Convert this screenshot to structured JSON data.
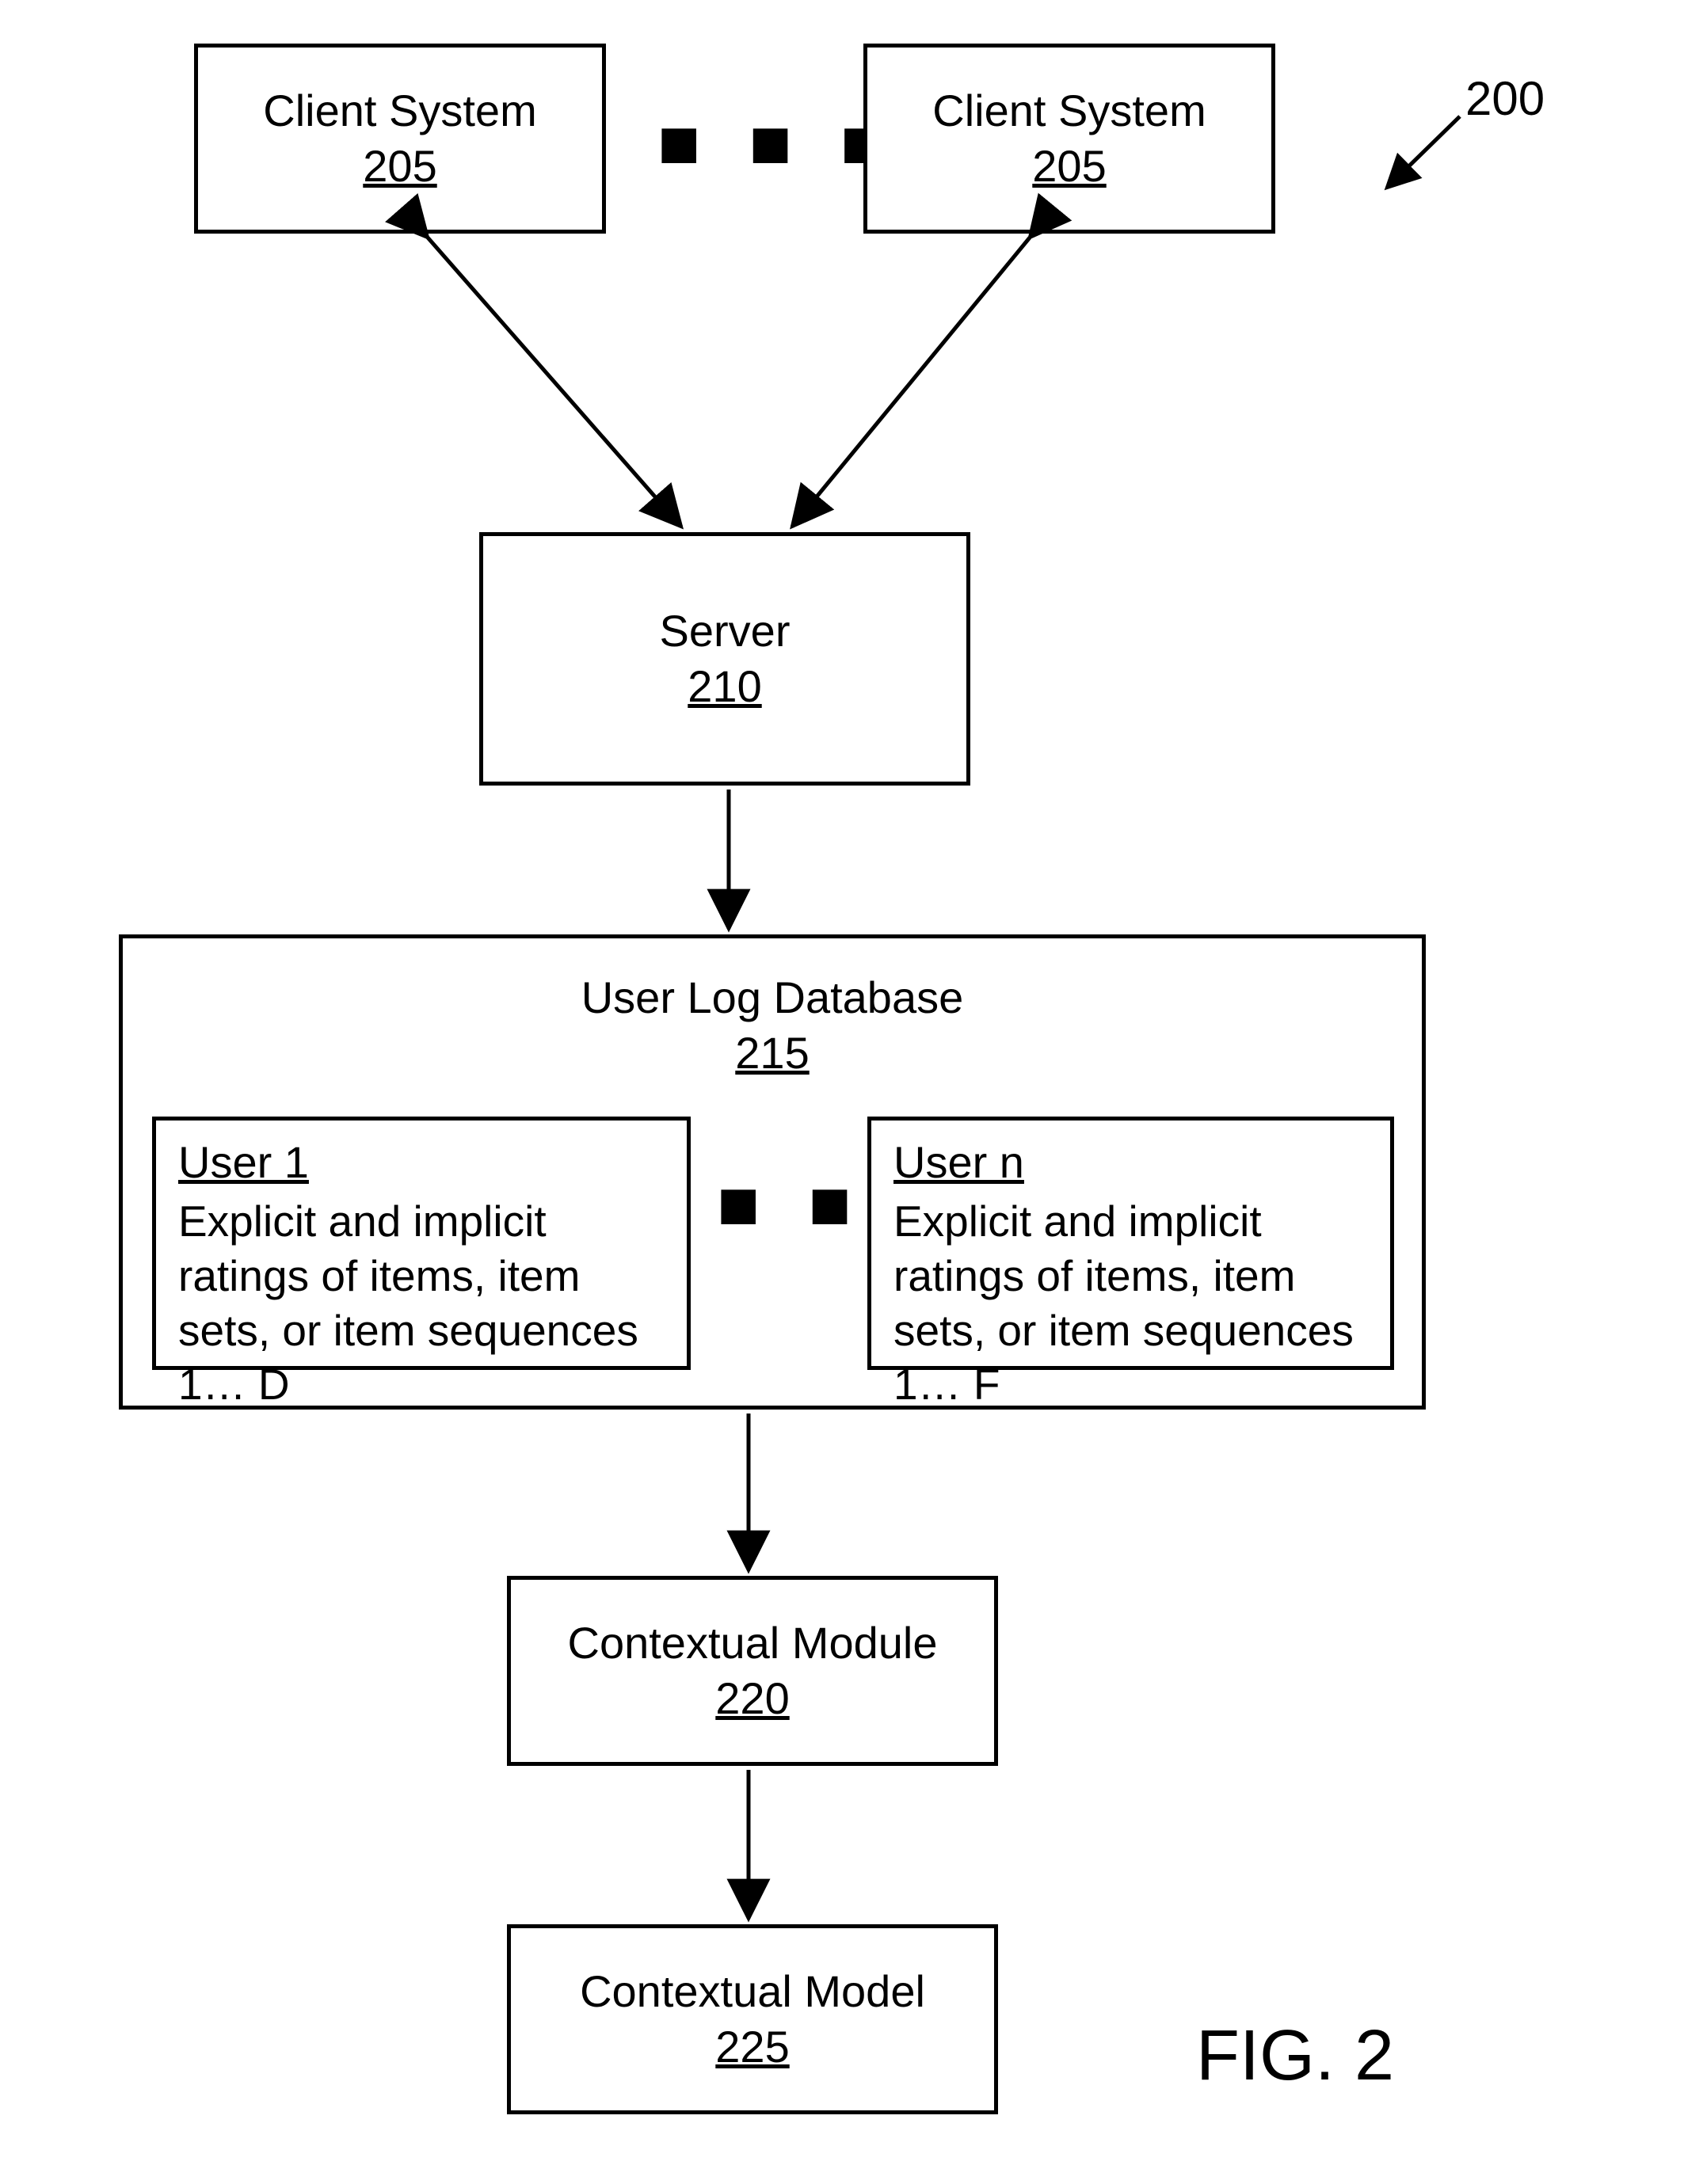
{
  "figure_label": "FIG. 2",
  "ref_number": "200",
  "boxes": {
    "client_left": {
      "title": "Client System",
      "num": "205"
    },
    "client_right": {
      "title": "Client System",
      "num": "205"
    },
    "server": {
      "title": "Server",
      "num": "210"
    },
    "userlog": {
      "title": "User Log Database",
      "num": "215"
    },
    "user1": {
      "title": "User 1",
      "body": "Explicit and implicit ratings of items, item sets, or item sequences 1… D"
    },
    "usern": {
      "title": "User n",
      "body": "Explicit and implicit ratings of items, item sets, or item sequences 1… F"
    },
    "ctx_module": {
      "title": "Contextual Module",
      "num": "220"
    },
    "ctx_model": {
      "title": "Contextual Model",
      "num": "225"
    }
  },
  "ellipsis": "■ ■ ■"
}
